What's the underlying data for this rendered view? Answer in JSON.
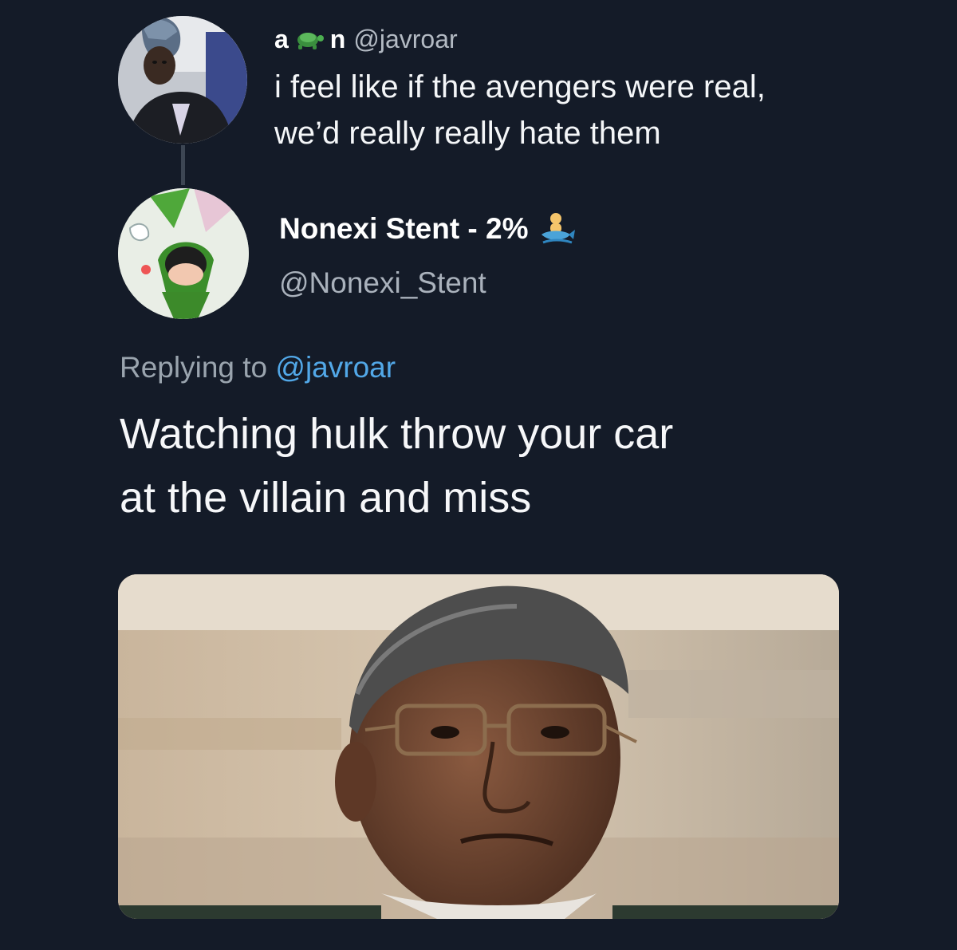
{
  "parent_tweet": {
    "name_start": "a",
    "name_end": "n",
    "handle": "@javroar",
    "text_line1": "i feel like if the avengers were real,",
    "text_line2": "we’d really really hate them"
  },
  "reply_tweet": {
    "display_name": "Nonexi Stent - 2%",
    "handle": "@Nonexi_Stent",
    "replying_prefix": "Replying to",
    "replying_mention": "@javroar",
    "text_line1": "Watching hulk throw your car",
    "text_line2": "at the villain and miss"
  },
  "icons": {
    "parent_name_emoji": "turtle-icon",
    "reply_name_emoji": "merman-icon"
  },
  "colors": {
    "background": "#141b28",
    "text_primary": "#f4f6f8",
    "text_secondary": "#aab2bc",
    "mention": "#52a8e8"
  }
}
